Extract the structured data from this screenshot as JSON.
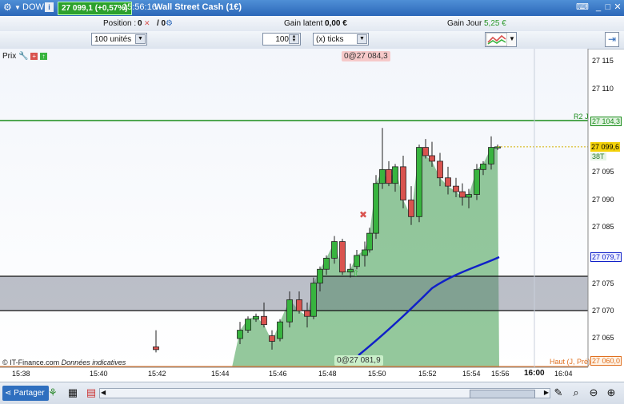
{
  "titlebar": {
    "menu_label": "DOW",
    "info_icon": "i",
    "price": "27 099,1 (+0,57%)",
    "time": "15:56:16",
    "instrument": "Wall Street Cash (1€)"
  },
  "infobar": {
    "position_label": "Position :",
    "position_value": "0",
    "position_slash": "/ 0",
    "gain_latent_label": "Gain latent :",
    "gain_latent_value": "0,00 €",
    "gain_jour_label": "Gain Jour :",
    "gain_jour_value": "5,25 €",
    "gain_jour_color": "#2e9b2e"
  },
  "toolbar": {
    "units_value": "100 unités",
    "ticks_value": "100",
    "ticks_unit": "(x) ticks"
  },
  "chart": {
    "prix_label": "Prix",
    "marker_top": "0@27 084,3",
    "marker_bottom": "0@27 081,9",
    "watermark": "© IT-Finance.com",
    "watermark_note": "Données indicatives",
    "r2_label": "R2 J",
    "r2_value": "27 104,3",
    "current_price": "27 099,6",
    "countdown": "38T",
    "ma_value": "27 079,7",
    "haut_label": "Haut (J, Pré)",
    "haut_value": "27 060,0",
    "y_ticks": [
      "27 115",
      "27 110",
      "27 095",
      "27 090",
      "27 085",
      "27 080",
      "27 075",
      "27 070",
      "27 065"
    ],
    "x_ticks": [
      "15:38",
      "15:40",
      "15:42",
      "15:44",
      "15:46",
      "15:48",
      "15:50",
      "15:52",
      "15:54",
      "15:56",
      "16:00",
      "16:04"
    ],
    "colors": {
      "up": "#38b43f",
      "down": "#d9534f",
      "area": "#3d9a4a",
      "ma": "#1020c8",
      "r2": "#1a8c1a",
      "band": "#6d7488"
    }
  },
  "bottombar": {
    "share_label": "Partager"
  }
}
